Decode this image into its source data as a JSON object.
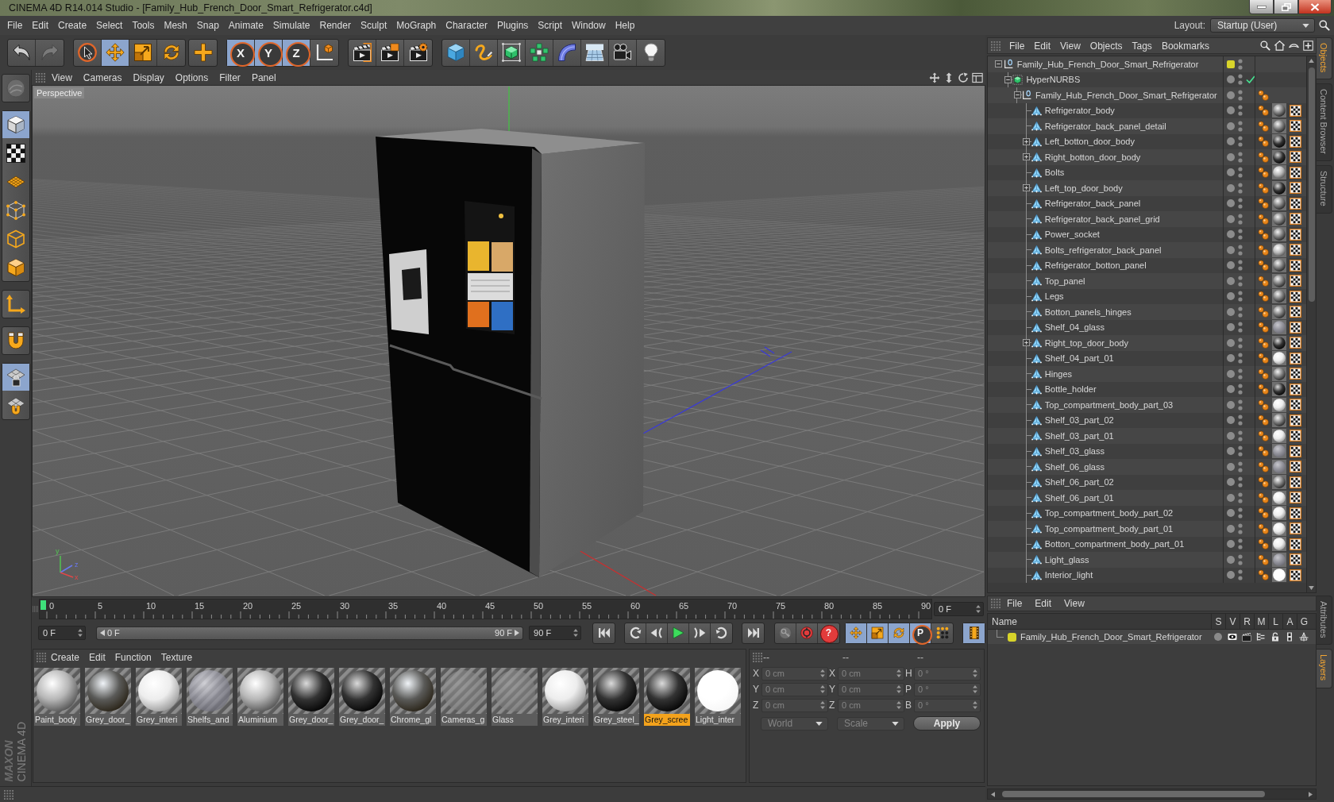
{
  "window": {
    "title": "CINEMA 4D R14.014 Studio - [Family_Hub_French_Door_Smart_Refrigerator.c4d]"
  },
  "menu": [
    "File",
    "Edit",
    "Create",
    "Select",
    "Tools",
    "Mesh",
    "Snap",
    "Animate",
    "Simulate",
    "Render",
    "Sculpt",
    "MoGraph",
    "Character",
    "Plugins",
    "Script",
    "Window",
    "Help"
  ],
  "layout": {
    "label": "Layout:",
    "value": "Startup (User)"
  },
  "toolbar": [
    [
      {
        "kind": "undo",
        "disabled": false
      },
      {
        "kind": "redo",
        "disabled": true
      }
    ],
    [
      {
        "kind": "select",
        "selected": false
      },
      {
        "kind": "move",
        "selected": true
      },
      {
        "kind": "scale",
        "selected": false
      },
      {
        "kind": "rotate",
        "selected": false
      }
    ],
    [
      {
        "kind": "add",
        "selected": false
      }
    ],
    [
      {
        "kind": "x-axis",
        "label": "X",
        "selected": true
      },
      {
        "kind": "y-axis",
        "label": "Y",
        "selected": true
      },
      {
        "kind": "z-axis",
        "label": "Z",
        "selected": true
      },
      {
        "kind": "coordinates",
        "selected": false
      }
    ],
    [
      {
        "kind": "render-view"
      },
      {
        "kind": "render-picture"
      },
      {
        "kind": "render-settings"
      }
    ],
    [
      {
        "kind": "cube"
      },
      {
        "kind": "spline"
      },
      {
        "kind": "subdivision"
      },
      {
        "kind": "cloner"
      },
      {
        "kind": "deformer"
      },
      {
        "kind": "floor"
      },
      {
        "kind": "camera"
      },
      {
        "kind": "light"
      }
    ]
  ],
  "tools": [
    [
      {
        "kind": "sculpt",
        "selected": false
      }
    ],
    [
      {
        "kind": "model",
        "selected": true
      },
      {
        "kind": "texture",
        "selected": false
      },
      {
        "kind": "workplane",
        "selected": false
      },
      {
        "kind": "points",
        "selected": false
      },
      {
        "kind": "edges",
        "selected": false
      },
      {
        "kind": "polygons",
        "selected": false
      }
    ],
    [
      {
        "kind": "axis",
        "selected": false
      }
    ],
    [
      {
        "kind": "tweak",
        "selected": false
      }
    ],
    [
      {
        "kind": "grid-lock",
        "selected": true
      },
      {
        "kind": "snap",
        "selected": false
      }
    ]
  ],
  "logo": {
    "brand": "MAXON",
    "product": "CINEMA 4D"
  },
  "viewport": {
    "menu": [
      "View",
      "Cameras",
      "Display",
      "Options",
      "Filter",
      "Panel"
    ],
    "camera": "Perspective",
    "gizmo_labels": [
      "y",
      "z",
      "x"
    ]
  },
  "timeline": {
    "labels": [
      "0",
      "5",
      "10",
      "15",
      "20",
      "25",
      "30",
      "35",
      "40",
      "45",
      "50",
      "55",
      "60",
      "65",
      "70",
      "75",
      "80",
      "85",
      "90"
    ],
    "level": 0,
    "frame": "0 F"
  },
  "transport": {
    "start": "0 F",
    "range": {
      "start": "0 F",
      "end": "90 F",
      "level": 1
    },
    "end": "90 F",
    "playback": [
      [
        {
          "kind": "first"
        }
      ],
      [
        {
          "kind": "prev-key"
        },
        {
          "kind": "prev-frame"
        },
        {
          "kind": "play"
        },
        {
          "kind": "next-frame"
        },
        {
          "kind": "next-key"
        }
      ],
      [
        {
          "kind": "last"
        }
      ]
    ],
    "keys": [
      {
        "kind": "record-active"
      },
      {
        "kind": "autokey"
      },
      {
        "kind": "keyframe-selection",
        "label": "?"
      }
    ],
    "channels": [
      {
        "kind": "position",
        "selected": true
      },
      {
        "kind": "scale",
        "selected": true
      },
      {
        "kind": "rotation",
        "selected": true
      },
      {
        "kind": "parameter",
        "label": "P",
        "selected": true
      },
      {
        "kind": "points",
        "selected": false
      }
    ],
    "scheme": {
      "selected": true
    }
  },
  "materials": {
    "menu": [
      "Create",
      "Edit",
      "Function",
      "Texture"
    ],
    "items": [
      {
        "name": "Paint_body",
        "kind": "silver",
        "selected": false
      },
      {
        "name": "Grey_door_",
        "kind": "env",
        "selected": false
      },
      {
        "name": "Grey_interi",
        "kind": "white",
        "selected": false
      },
      {
        "name": "Shelfs_and",
        "kind": "glass",
        "selected": false
      },
      {
        "name": "Aluminium",
        "kind": "silver",
        "selected": false
      },
      {
        "name": "Grey_door_",
        "kind": "dark",
        "selected": false
      },
      {
        "name": "Grey_door_",
        "kind": "dark",
        "selected": false
      },
      {
        "name": "Chrome_gl",
        "kind": "env",
        "selected": false
      },
      {
        "name": "Cameras_g",
        "kind": "flat",
        "selected": false
      },
      {
        "name": "Glass",
        "kind": "flat",
        "selected": false
      },
      {
        "name": "Grey_interi",
        "kind": "white",
        "selected": false
      },
      {
        "name": "Grey_steel_",
        "kind": "dark",
        "selected": false
      },
      {
        "name": "Grey_scree",
        "kind": "dark",
        "selected": true
      },
      {
        "name": "Light_inter",
        "kind": "light",
        "selected": false
      }
    ]
  },
  "coordinates": {
    "headers": [
      "--",
      "--",
      "--"
    ],
    "disabled": true,
    "rows": [
      [
        {
          "label": "X",
          "value": "0 cm"
        },
        {
          "label": "X",
          "value": "0 cm"
        },
        {
          "label": "H",
          "value": "0 °"
        }
      ],
      [
        {
          "label": "Y",
          "value": "0 cm"
        },
        {
          "label": "Y",
          "value": "0 cm"
        },
        {
          "label": "P",
          "value": "0 °"
        }
      ],
      [
        {
          "label": "Z",
          "value": "0 cm"
        },
        {
          "label": "Z",
          "value": "0 cm"
        },
        {
          "label": "B",
          "value": "0 °"
        }
      ]
    ],
    "dropdowns": [
      "World",
      "Scale"
    ],
    "apply": "Apply"
  },
  "objects": {
    "menu": [
      "File",
      "Edit",
      "View",
      "Objects",
      "Tags",
      "Bookmarks"
    ],
    "tree": [
      {
        "name": "Family_Hub_French_Door_Smart_Refrigerator",
        "kind": "null",
        "collapsed": false,
        "color": "#d8d42a",
        "children": [
          {
            "name": "HyperNURBS",
            "kind": "hypernurbs",
            "collapsed": false,
            "enabled": true,
            "children": [
              {
                "name": "Family_Hub_French_Door_Smart_Refrigerator",
                "kind": "null",
                "collapsed": false,
                "tags": [
                  {
                    "kind": "phong"
                  }
                ],
                "children": [
                  {
                    "name": "Refrigerator_body",
                    "kind": "polygon",
                    "collapsed": false,
                    "tags": [
                      {
                        "kind": "phong"
                      },
                      {
                        "kind": "sphere-grey"
                      },
                      {
                        "kind": "uvw"
                      }
                    ]
                  },
                  {
                    "name": "Refrigerator_back_panel_detail",
                    "kind": "polygon",
                    "collapsed": false,
                    "tags": [
                      {
                        "kind": "phong"
                      },
                      {
                        "kind": "sphere-grey"
                      },
                      {
                        "kind": "uvw"
                      }
                    ]
                  },
                  {
                    "name": "Left_botton_door_body",
                    "kind": "polygon",
                    "collapsed": true,
                    "tags": [
                      {
                        "kind": "phong"
                      },
                      {
                        "kind": "sphere-dark"
                      },
                      {
                        "kind": "uvw"
                      }
                    ]
                  },
                  {
                    "name": "Right_botton_door_body",
                    "kind": "polygon",
                    "collapsed": true,
                    "tags": [
                      {
                        "kind": "phong"
                      },
                      {
                        "kind": "sphere-dark"
                      },
                      {
                        "kind": "uvw"
                      }
                    ]
                  },
                  {
                    "name": "Bolts",
                    "kind": "polygon",
                    "collapsed": false,
                    "tags": [
                      {
                        "kind": "phong"
                      },
                      {
                        "kind": "sphere-silver"
                      },
                      {
                        "kind": "uvw"
                      }
                    ]
                  },
                  {
                    "name": "Left_top_door_body",
                    "kind": "polygon",
                    "collapsed": true,
                    "tags": [
                      {
                        "kind": "phong"
                      },
                      {
                        "kind": "sphere-dark"
                      },
                      {
                        "kind": "uvw"
                      }
                    ]
                  },
                  {
                    "name": "Refrigerator_back_panel",
                    "kind": "polygon",
                    "collapsed": false,
                    "tags": [
                      {
                        "kind": "phong"
                      },
                      {
                        "kind": "sphere-grey"
                      },
                      {
                        "kind": "uvw"
                      }
                    ]
                  },
                  {
                    "name": "Refrigerator_back_panel_grid",
                    "kind": "polygon",
                    "collapsed": false,
                    "tags": [
                      {
                        "kind": "phong"
                      },
                      {
                        "kind": "sphere-grey"
                      },
                      {
                        "kind": "uvw"
                      }
                    ]
                  },
                  {
                    "name": "Power_socket",
                    "kind": "polygon",
                    "collapsed": false,
                    "tags": [
                      {
                        "kind": "phong"
                      },
                      {
                        "kind": "sphere-grey"
                      },
                      {
                        "kind": "uvw"
                      }
                    ]
                  },
                  {
                    "name": "Bolts_refrigerator_back_panel",
                    "kind": "polygon",
                    "collapsed": false,
                    "tags": [
                      {
                        "kind": "phong"
                      },
                      {
                        "kind": "sphere-silver"
                      },
                      {
                        "kind": "uvw"
                      }
                    ]
                  },
                  {
                    "name": "Refrigerator_botton_panel",
                    "kind": "polygon",
                    "collapsed": false,
                    "tags": [
                      {
                        "kind": "phong"
                      },
                      {
                        "kind": "sphere-grey"
                      },
                      {
                        "kind": "uvw"
                      }
                    ]
                  },
                  {
                    "name": "Top_panel",
                    "kind": "polygon",
                    "collapsed": false,
                    "tags": [
                      {
                        "kind": "phong"
                      },
                      {
                        "kind": "sphere-grey"
                      },
                      {
                        "kind": "uvw"
                      }
                    ]
                  },
                  {
                    "name": "Legs",
                    "kind": "polygon",
                    "collapsed": false,
                    "tags": [
                      {
                        "kind": "phong"
                      },
                      {
                        "kind": "sphere-grey"
                      },
                      {
                        "kind": "uvw"
                      }
                    ]
                  },
                  {
                    "name": "Botton_panels_hinges",
                    "kind": "polygon",
                    "collapsed": false,
                    "tags": [
                      {
                        "kind": "phong"
                      },
                      {
                        "kind": "sphere-grey"
                      },
                      {
                        "kind": "uvw"
                      }
                    ]
                  },
                  {
                    "name": "Shelf_04_glass",
                    "kind": "polygon",
                    "collapsed": false,
                    "tags": [
                      {
                        "kind": "phong"
                      },
                      {
                        "kind": "sphere-glass"
                      },
                      {
                        "kind": "uvw"
                      }
                    ]
                  },
                  {
                    "name": "Right_top_door_body",
                    "kind": "polygon",
                    "collapsed": true,
                    "tags": [
                      {
                        "kind": "phong"
                      },
                      {
                        "kind": "sphere-dark"
                      },
                      {
                        "kind": "uvw"
                      }
                    ]
                  },
                  {
                    "name": "Shelf_04_part_01",
                    "kind": "polygon",
                    "collapsed": false,
                    "tags": [
                      {
                        "kind": "phong"
                      },
                      {
                        "kind": "sphere-white"
                      },
                      {
                        "kind": "uvw"
                      }
                    ]
                  },
                  {
                    "name": "Hinges",
                    "kind": "polygon",
                    "collapsed": false,
                    "tags": [
                      {
                        "kind": "phong"
                      },
                      {
                        "kind": "sphere-grey"
                      },
                      {
                        "kind": "uvw"
                      }
                    ]
                  },
                  {
                    "name": "Bottle_holder",
                    "kind": "polygon",
                    "collapsed": false,
                    "tags": [
                      {
                        "kind": "phong"
                      },
                      {
                        "kind": "sphere-dark"
                      },
                      {
                        "kind": "uvw"
                      }
                    ]
                  },
                  {
                    "name": "Top_compartment_body_part_03",
                    "kind": "polygon",
                    "collapsed": false,
                    "tags": [
                      {
                        "kind": "phong"
                      },
                      {
                        "kind": "sphere-white"
                      },
                      {
                        "kind": "uvw"
                      }
                    ]
                  },
                  {
                    "name": "Shelf_03_part_02",
                    "kind": "polygon",
                    "collapsed": false,
                    "tags": [
                      {
                        "kind": "phong"
                      },
                      {
                        "kind": "sphere-grey"
                      },
                      {
                        "kind": "uvw"
                      }
                    ]
                  },
                  {
                    "name": "Shelf_03_part_01",
                    "kind": "polygon",
                    "collapsed": false,
                    "tags": [
                      {
                        "kind": "phong"
                      },
                      {
                        "kind": "sphere-white"
                      },
                      {
                        "kind": "uvw"
                      }
                    ]
                  },
                  {
                    "name": "Shelf_03_glass",
                    "kind": "polygon",
                    "collapsed": false,
                    "tags": [
                      {
                        "kind": "phong"
                      },
                      {
                        "kind": "sphere-glass"
                      },
                      {
                        "kind": "uvw"
                      }
                    ]
                  },
                  {
                    "name": "Shelf_06_glass",
                    "kind": "polygon",
                    "collapsed": false,
                    "tags": [
                      {
                        "kind": "phong"
                      },
                      {
                        "kind": "sphere-glass"
                      },
                      {
                        "kind": "uvw"
                      }
                    ]
                  },
                  {
                    "name": "Shelf_06_part_02",
                    "kind": "polygon",
                    "collapsed": false,
                    "tags": [
                      {
                        "kind": "phong"
                      },
                      {
                        "kind": "sphere-grey"
                      },
                      {
                        "kind": "uvw"
                      }
                    ]
                  },
                  {
                    "name": "Shelf_06_part_01",
                    "kind": "polygon",
                    "collapsed": false,
                    "tags": [
                      {
                        "kind": "phong"
                      },
                      {
                        "kind": "sphere-white"
                      },
                      {
                        "kind": "uvw"
                      }
                    ]
                  },
                  {
                    "name": "Top_compartment_body_part_02",
                    "kind": "polygon",
                    "collapsed": false,
                    "tags": [
                      {
                        "kind": "phong"
                      },
                      {
                        "kind": "sphere-white"
                      },
                      {
                        "kind": "uvw"
                      }
                    ]
                  },
                  {
                    "name": "Top_compartment_body_part_01",
                    "kind": "polygon",
                    "collapsed": false,
                    "tags": [
                      {
                        "kind": "phong"
                      },
                      {
                        "kind": "sphere-white"
                      },
                      {
                        "kind": "uvw"
                      }
                    ]
                  },
                  {
                    "name": "Botton_compartment_body_part_01",
                    "kind": "polygon",
                    "collapsed": false,
                    "tags": [
                      {
                        "kind": "phong"
                      },
                      {
                        "kind": "sphere-white"
                      },
                      {
                        "kind": "uvw"
                      }
                    ]
                  },
                  {
                    "name": "Light_glass",
                    "kind": "polygon",
                    "collapsed": false,
                    "tags": [
                      {
                        "kind": "phong"
                      },
                      {
                        "kind": "sphere-glass"
                      },
                      {
                        "kind": "uvw"
                      }
                    ]
                  },
                  {
                    "name": "Interior_light",
                    "kind": "polygon",
                    "collapsed": false,
                    "tags": [
                      {
                        "kind": "phong"
                      },
                      {
                        "kind": "sphere-light"
                      },
                      {
                        "kind": "uvw"
                      }
                    ]
                  }
                ]
              }
            ]
          }
        ]
      }
    ]
  },
  "layers": {
    "menu": [
      "File",
      "Edit",
      "View"
    ],
    "columns": [
      "Name",
      "S",
      "V",
      "R",
      "M",
      "L",
      "A",
      "G"
    ],
    "rows": [
      {
        "name": "Family_Hub_French_Door_Smart_Refrigerator",
        "color": "#d8d42a"
      }
    ]
  },
  "side_tabs": {
    "top": [
      {
        "label": "Objects",
        "selected": true
      },
      {
        "label": "Content Browser",
        "selected": false
      },
      {
        "label": "Structure",
        "selected": false
      }
    ],
    "bottom": [
      {
        "label": "Attributes",
        "selected": false
      },
      {
        "label": "Layers",
        "selected": true
      }
    ]
  }
}
